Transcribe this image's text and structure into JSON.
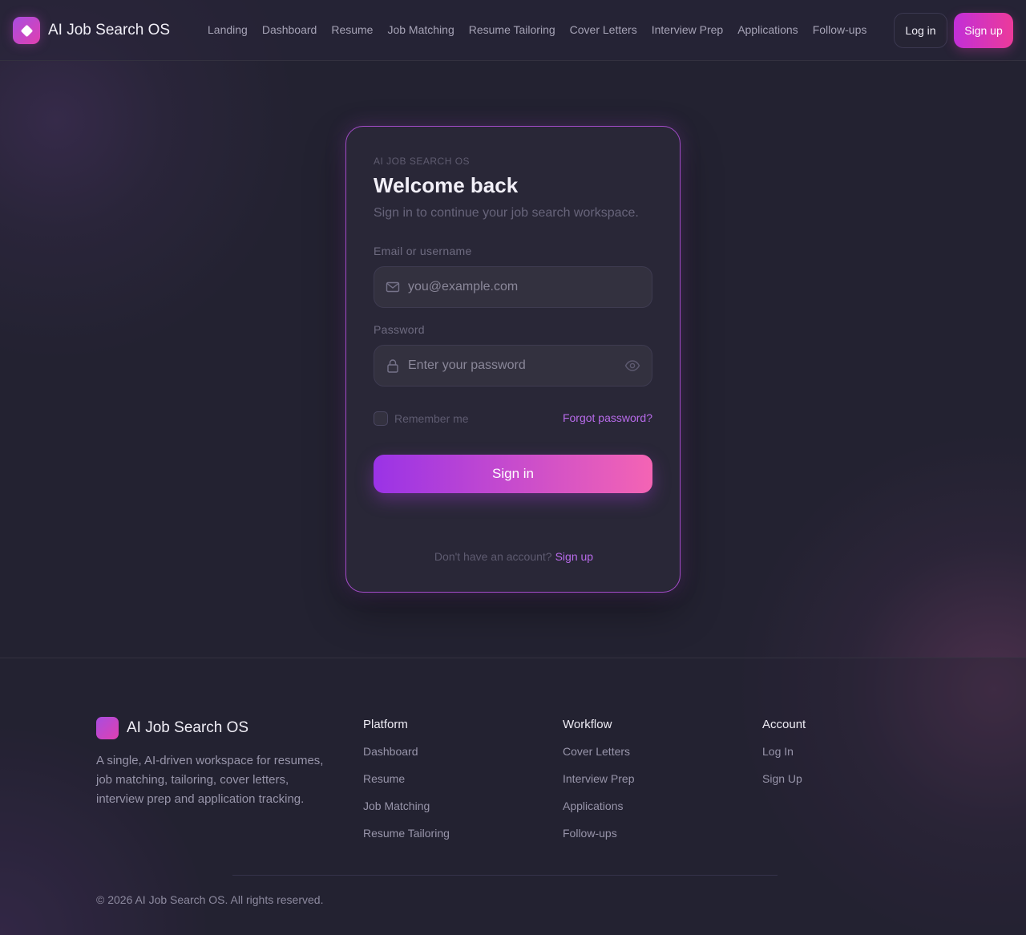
{
  "header": {
    "brand": "AI Job Search OS",
    "nav": [
      "Landing",
      "Dashboard",
      "Resume",
      "Job Matching",
      "Resume Tailoring",
      "Cover Letters",
      "Interview Prep",
      "Applications",
      "Follow-ups"
    ],
    "login_label": "Log in",
    "signup_label": "Sign up"
  },
  "card": {
    "eyebrow": "AI JOB SEARCH OS",
    "title": "Welcome back",
    "subtitle": "Sign in to continue your job search workspace.",
    "email_label": "Email or username",
    "email_placeholder": "you@example.com",
    "password_label": "Password",
    "password_placeholder": "Enter your password",
    "remember_label": "Remember me",
    "forgot_label": "Forgot password?",
    "signin_label": "Sign in",
    "no_account_text": "Don't have an account?",
    "signup_link": "Sign up"
  },
  "footer": {
    "brand": "AI Job Search OS",
    "description": "A single, AI-driven workspace for resumes, job matching, tailoring, cover letters, interview prep and application tracking.",
    "columns": [
      {
        "title": "Platform",
        "links": [
          "Dashboard",
          "Resume",
          "Job Matching",
          "Resume Tailoring"
        ]
      },
      {
        "title": "Workflow",
        "links": [
          "Cover Letters",
          "Interview Prep",
          "Applications",
          "Follow-ups"
        ]
      },
      {
        "title": "Account",
        "links": [
          "Log In",
          "Sign Up"
        ]
      }
    ],
    "copyright": "© 2026 AI Job Search OS. All rights reserved."
  },
  "colors": {
    "background": "#232231",
    "accent_purple": "#9a33e6",
    "accent_pink": "#f464b4",
    "link": "#b86bea"
  },
  "icons": [
    "logo-icon",
    "mail-icon",
    "lock-icon",
    "eye-icon"
  ]
}
